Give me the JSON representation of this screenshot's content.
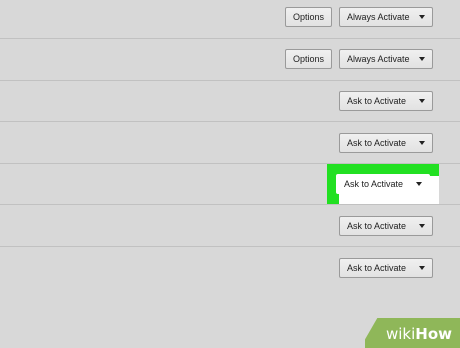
{
  "plugins": [
    {
      "options_label": "Options",
      "activation": "Always Activate",
      "highlighted": false
    },
    {
      "options_label": "Options",
      "activation": "Always Activate",
      "highlighted": false
    },
    {
      "activation": "Ask to Activate",
      "highlighted": false
    },
    {
      "activation": "Ask to Activate",
      "highlighted": false
    },
    {
      "activation": "Ask to Activate",
      "highlighted": true
    },
    {
      "activation": "Ask to Activate",
      "highlighted": false
    },
    {
      "activation": "Ask to Activate",
      "highlighted": false
    }
  ],
  "highlight_color": "#22e022",
  "watermark": {
    "part1": "wiki",
    "part2": "How",
    "color": "#8bb552"
  }
}
